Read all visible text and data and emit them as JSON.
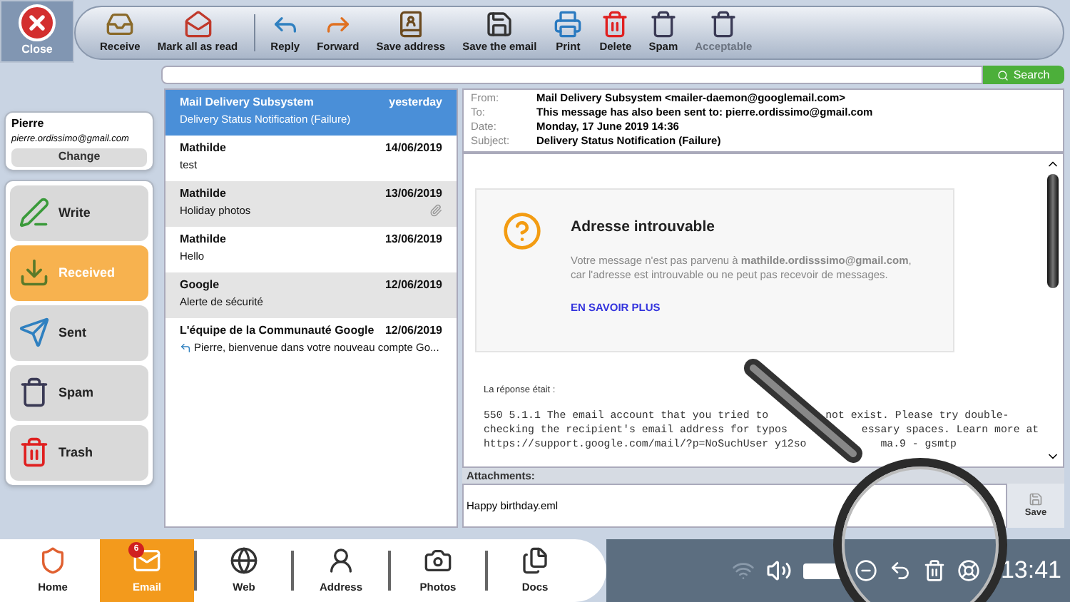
{
  "toolbar": {
    "close": "Close",
    "buttons": [
      {
        "label": "Receive",
        "kind": "receive",
        "disabled": false
      },
      {
        "label": "Mark all as read",
        "kind": "mark-read",
        "disabled": false
      },
      {
        "label": "Reply",
        "kind": "reply",
        "disabled": false
      },
      {
        "label": "Forward",
        "kind": "forward",
        "disabled": false
      },
      {
        "label": "Save address",
        "kind": "save-address",
        "disabled": false
      },
      {
        "label": "Save the email",
        "kind": "save-email",
        "disabled": false
      },
      {
        "label": "Print",
        "kind": "print",
        "disabled": false
      },
      {
        "label": "Delete",
        "kind": "delete",
        "disabled": false
      },
      {
        "label": "Spam",
        "kind": "spam",
        "disabled": false
      },
      {
        "label": "Acceptable",
        "kind": "acceptable",
        "disabled": true
      }
    ]
  },
  "search": {
    "button": "Search"
  },
  "account": {
    "name": "Pierre",
    "email": "pierre.ordissimo@gmail.com",
    "change": "Change"
  },
  "folders": [
    {
      "label": "Write",
      "kind": "write",
      "selected": false
    },
    {
      "label": "Received",
      "kind": "received",
      "selected": true
    },
    {
      "label": "Sent",
      "kind": "sent",
      "selected": false
    },
    {
      "label": "Spam",
      "kind": "spam",
      "selected": false
    },
    {
      "label": "Trash",
      "kind": "trash",
      "selected": false
    }
  ],
  "messages": [
    {
      "sender": "Mail Delivery Subsystem",
      "date": "yesterday",
      "subject": "Delivery Status Notification (Failure)",
      "selected": true,
      "attachment": false,
      "replied": false
    },
    {
      "sender": "Mathilde",
      "date": "14/06/2019",
      "subject": "test",
      "selected": false,
      "attachment": false,
      "replied": false
    },
    {
      "sender": "Mathilde",
      "date": "13/06/2019",
      "subject": "Holiday photos",
      "selected": false,
      "attachment": true,
      "replied": false
    },
    {
      "sender": "Mathilde",
      "date": "13/06/2019",
      "subject": "Hello",
      "selected": false,
      "attachment": false,
      "replied": false
    },
    {
      "sender": "Google",
      "date": "12/06/2019",
      "subject": "Alerte de sécurité",
      "selected": false,
      "attachment": false,
      "replied": false
    },
    {
      "sender": "L'équipe de la Communauté Google",
      "date": "12/06/2019",
      "subject": "Pierre, bienvenue dans votre nouveau compte Go...",
      "selected": false,
      "attachment": false,
      "replied": true
    }
  ],
  "header": [
    {
      "label": "From:",
      "value": "Mail Delivery Subsystem <mailer-daemon@googlemail.com>"
    },
    {
      "label": "To:",
      "value": "This message has also been sent to: pierre.ordissimo@gmail.com"
    },
    {
      "label": "Date:",
      "value": "Monday, 17 June 2019 14:36"
    },
    {
      "label": "Subject:",
      "value": "Delivery Status Notification (Failure)"
    }
  ],
  "body": {
    "title": "Adresse introuvable",
    "text": "Votre message n'est pas parvenu à **mathilde.ordisssimo@gmail.com**, car l'adresse est introuvable ou ne peut pas recevoir de messages.",
    "link": "EN SAVOIR PLUS",
    "response_label": "La réponse était :",
    "response_lines": [
      [
        "550 5.1.1 The email account that you tried to",
        "not exist. Please try double-"
      ],
      [
        "checking the recipient's email address for typos",
        "essary spaces. Learn more at"
      ],
      [
        "https://support.google.com/mail/?p=NoSuchUser y12so",
        "ma.9 - gsmtp"
      ]
    ]
  },
  "attachments": {
    "label": "Attachments:",
    "files": [
      "Happy birthday.eml"
    ],
    "save": "Save"
  },
  "dock": [
    {
      "label": "Home",
      "kind": "home",
      "selected": false
    },
    {
      "label": "Email",
      "kind": "email",
      "selected": true,
      "badge": "6"
    },
    {
      "label": "Web",
      "kind": "web",
      "selected": false
    },
    {
      "label": "Address",
      "kind": "address",
      "selected": false
    },
    {
      "label": "Photos",
      "kind": "photos",
      "selected": false
    },
    {
      "label": "Docs",
      "kind": "docs",
      "selected": false
    }
  ],
  "clock": "13:41"
}
